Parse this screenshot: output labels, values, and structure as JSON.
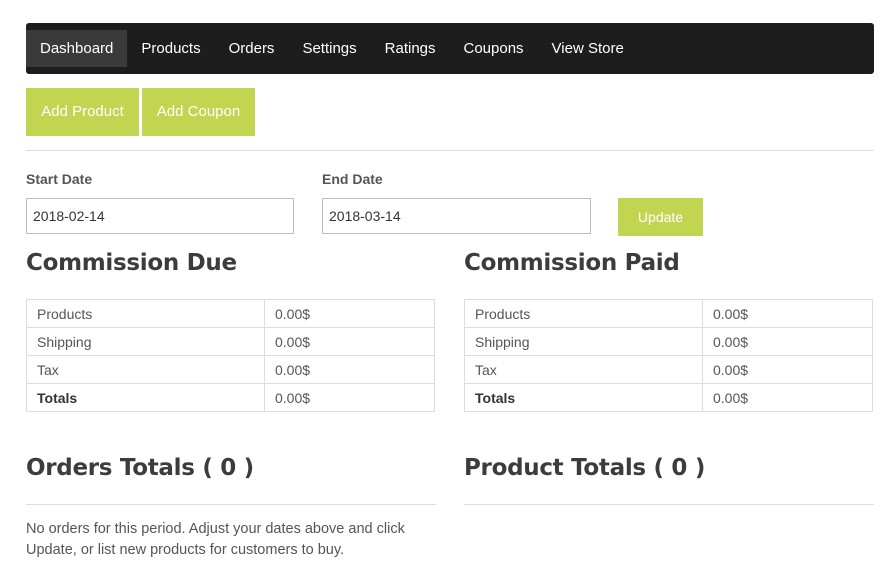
{
  "nav": {
    "items": [
      "Dashboard",
      "Products",
      "Orders",
      "Settings",
      "Ratings",
      "Coupons",
      "View Store"
    ],
    "active": "Dashboard"
  },
  "actions": {
    "add_product": "Add Product",
    "add_coupon": "Add Coupon"
  },
  "filters": {
    "start_label": "Start Date",
    "start_value": "2018-02-14",
    "end_label": "End Date",
    "end_value": "2018-03-14",
    "update_label": "Update"
  },
  "commission_due": {
    "title": "Commission Due",
    "rows": [
      {
        "label": "Products",
        "value": "0.00$"
      },
      {
        "label": "Shipping",
        "value": "0.00$"
      },
      {
        "label": "Tax",
        "value": "0.00$"
      },
      {
        "label": "Totals",
        "value": "0.00$"
      }
    ]
  },
  "commission_paid": {
    "title": "Commission Paid",
    "rows": [
      {
        "label": "Products",
        "value": "0.00$"
      },
      {
        "label": "Shipping",
        "value": "0.00$"
      },
      {
        "label": "Tax",
        "value": "0.00$"
      },
      {
        "label": "Totals",
        "value": "0.00$"
      }
    ]
  },
  "orders_totals": {
    "title": "Orders Totals ( 0 )",
    "empty_message": "No orders for this period. Adjust your dates above and click Update, or list new products for customers to buy."
  },
  "product_totals": {
    "title": "Product Totals ( 0 )"
  },
  "colors": {
    "accent": "#c2d550",
    "nav_bg": "#1d1d1d",
    "nav_active": "#3a3a3a"
  }
}
